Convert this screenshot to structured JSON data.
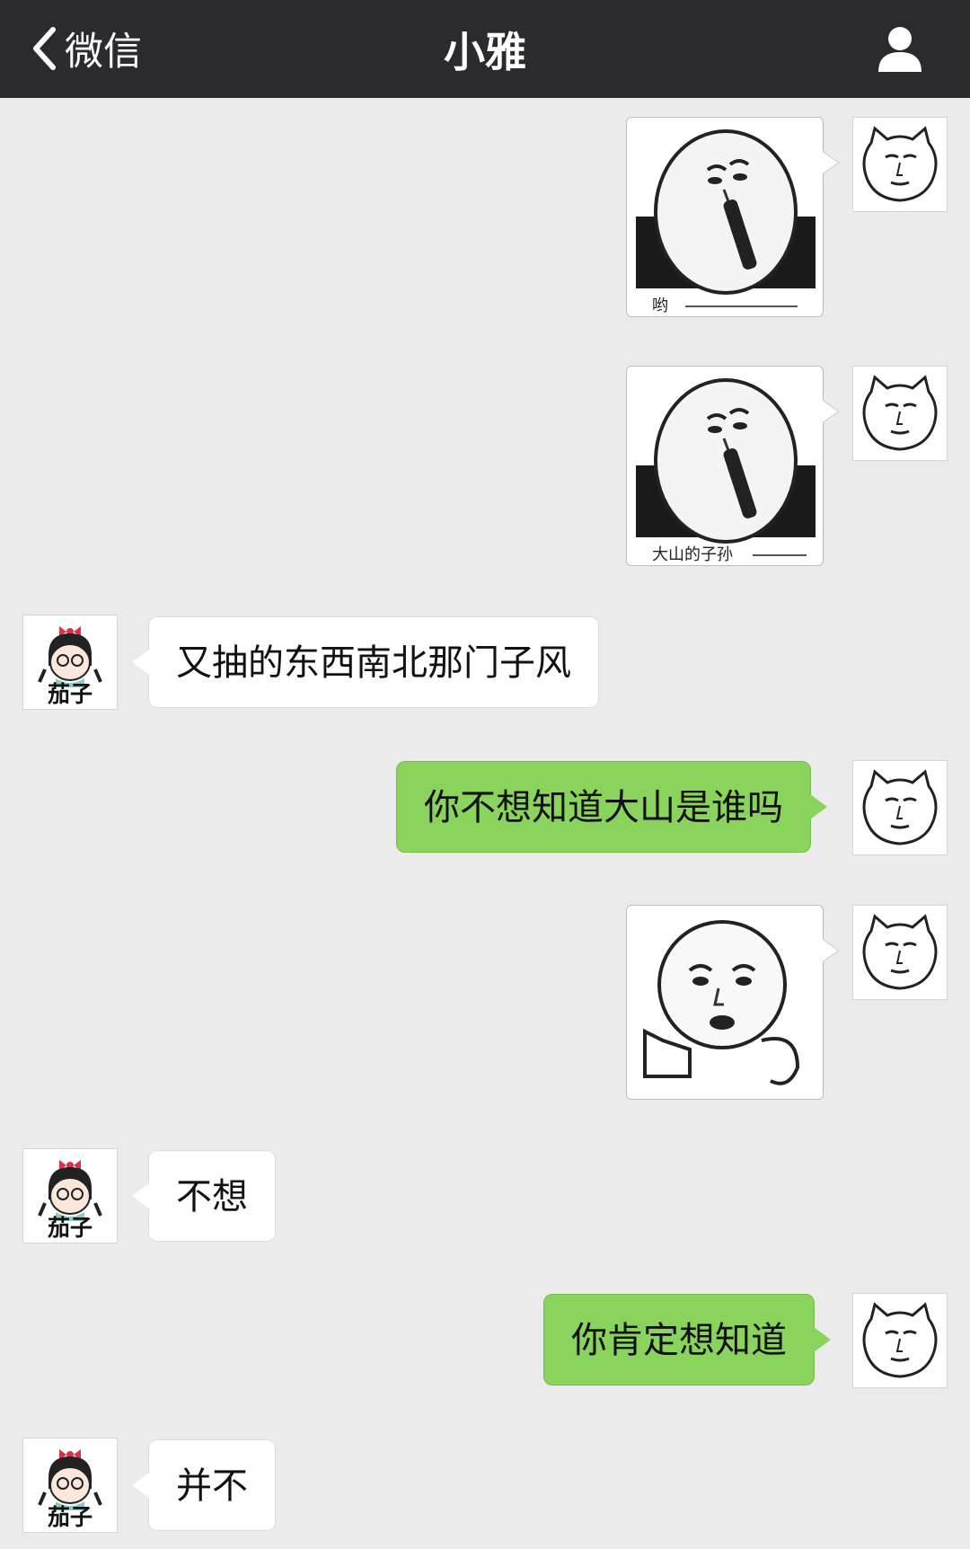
{
  "navbar": {
    "back_label": "微信",
    "title": "小雅",
    "back_icon": "chevron-left-icon",
    "profile_icon": "person-icon"
  },
  "contact": {
    "avatar_name": "茄子"
  },
  "colors": {
    "navbar_bg": "#2b2b2f",
    "chat_bg": "#ebebeb",
    "outgoing_bubble": "#8ad45d",
    "incoming_bubble": "#ffffff"
  },
  "messages": [
    {
      "from": "me",
      "type": "sticker",
      "caption": "哟"
    },
    {
      "from": "me",
      "type": "sticker",
      "caption": "大山的子孙"
    },
    {
      "from": "contact",
      "type": "text",
      "text": "又抽的东西南北那门子风"
    },
    {
      "from": "me",
      "type": "text",
      "text": "你不想知道大山是谁吗"
    },
    {
      "from": "me",
      "type": "sticker",
      "caption": ""
    },
    {
      "from": "contact",
      "type": "text",
      "text": "不想"
    },
    {
      "from": "me",
      "type": "text",
      "text": "你肯定想知道"
    },
    {
      "from": "contact",
      "type": "text",
      "text": "并不"
    }
  ]
}
